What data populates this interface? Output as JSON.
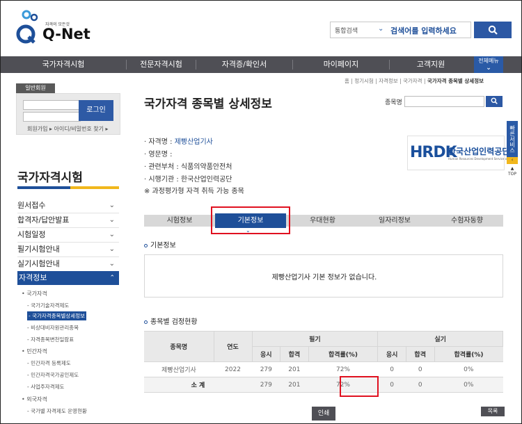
{
  "header": {
    "logo_text": "Q-Net",
    "logo_tagline": "자격의 모든것",
    "search_scope": "통합검색",
    "search_placeholder": "검색어를 입력하세요"
  },
  "nav": {
    "items": [
      "국가자격시험",
      "전문자격시험",
      "자격증/확인서",
      "마이페이지",
      "고객지원"
    ],
    "all_menu": "전체메뉴"
  },
  "login": {
    "tab": "일반회원",
    "button": "로그인",
    "links": "회원가입 ▸ 아이디/비밀번호 찾기 ▸"
  },
  "sidebar": {
    "title": "국가자격시험",
    "menu": [
      "원서접수",
      "합격자/답안발표",
      "시험일정",
      "필기시험안내",
      "실기시험안내"
    ],
    "active": "자격정보",
    "sub": [
      {
        "label": "국가자격",
        "level": 1
      },
      {
        "label": "국가기술자격제도",
        "level": 2
      },
      {
        "label": "국가자격종목별상세정보",
        "level": 2,
        "active": true
      },
      {
        "label": "비상대비자원관리종목",
        "level": 2
      },
      {
        "label": "자격종목변천일람표",
        "level": 2
      },
      {
        "label": "민간자격",
        "level": 1
      },
      {
        "label": "민간자격 등록제도",
        "level": 2
      },
      {
        "label": "민간자격국가공인제도",
        "level": 2
      },
      {
        "label": "사업주자격제도",
        "level": 2
      },
      {
        "label": "외국자격",
        "level": 1
      },
      {
        "label": "국가별 자격제도 운영현황",
        "level": 2
      }
    ]
  },
  "breadcrumb": {
    "items": "홈 | 정기시험 | 자격정보 | 국가자격 |",
    "current": "국가자격 종목별 상세정보"
  },
  "page": {
    "title": "국가자격 종목별 상세정보",
    "jongmok_label": "종목명"
  },
  "info": {
    "name_label": "· 자격명 : ",
    "name_value": "제빵산업기사",
    "eng_label": "· 영문명 :",
    "dept_label": "· 관련부처 : ",
    "dept_value": "식품의약품안전처",
    "org_label": "· 시행기관 : ",
    "org_value": "한국산업인력공단",
    "note": "※ 과정평가형 자격 취득 가능 종목"
  },
  "org_logo": {
    "mark": "HRDK",
    "name": "한국산업인력공단",
    "name_en": "Human Resources Development Service of Korea"
  },
  "side_tab": {
    "label": "빠른서비스",
    "top": "TOP"
  },
  "tabs": {
    "items": [
      "시험정보",
      "기본정보",
      "우대현황",
      "일자리정보",
      "수험자동향"
    ],
    "active": "기본정보"
  },
  "basic_info": {
    "title": "기본정보",
    "message": "제빵산업기사 기본 정보가 없습니다."
  },
  "stats": {
    "title": "종목별 검정현황",
    "headers": {
      "name": "종목명",
      "year": "연도",
      "written": "필기",
      "practical": "실기",
      "apply": "응시",
      "pass": "합격",
      "rate": "합격률(%)"
    },
    "rows": [
      {
        "name": "제빵산업기사",
        "year": "2022",
        "w_apply": "279",
        "w_pass": "201",
        "w_rate": "72%",
        "p_apply": "0",
        "p_pass": "0",
        "p_rate": "0%"
      }
    ],
    "total": {
      "name": "소 계",
      "year": "",
      "w_apply": "279",
      "w_pass": "201",
      "w_rate": "72%",
      "p_apply": "0",
      "p_pass": "0",
      "p_rate": "0%"
    }
  },
  "buttons": {
    "print": "인쇄",
    "list": "목록"
  },
  "colors": {
    "brand_blue": "#1e4f99",
    "nav_gray": "#4f4f55",
    "highlight_red": "#e0101f",
    "accent_yellow": "#f1b71c"
  }
}
